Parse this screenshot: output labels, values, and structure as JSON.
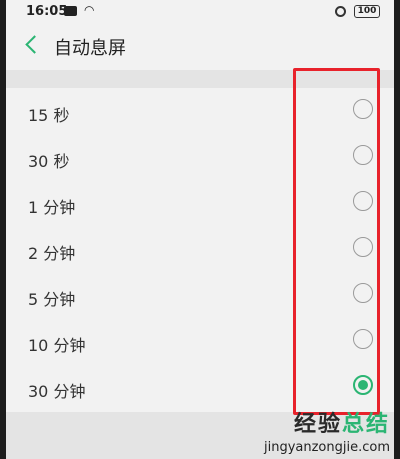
{
  "status_bar": {
    "time": "16:05",
    "battery": "100"
  },
  "header": {
    "title": "自动息屏"
  },
  "options": [
    {
      "label": "15 秒",
      "checked": false
    },
    {
      "label": "30 秒",
      "checked": false
    },
    {
      "label": "1 分钟",
      "checked": false
    },
    {
      "label": "2 分钟",
      "checked": false
    },
    {
      "label": "5 分钟",
      "checked": false
    },
    {
      "label": "10 分钟",
      "checked": false
    },
    {
      "label": "30 分钟",
      "checked": true
    }
  ],
  "watermark": {
    "main_a": "经验",
    "main_b": "总结",
    "url": "jingyanzongjie.com"
  },
  "colors": {
    "accent": "#2bb573",
    "annotation": "#e8222b"
  }
}
